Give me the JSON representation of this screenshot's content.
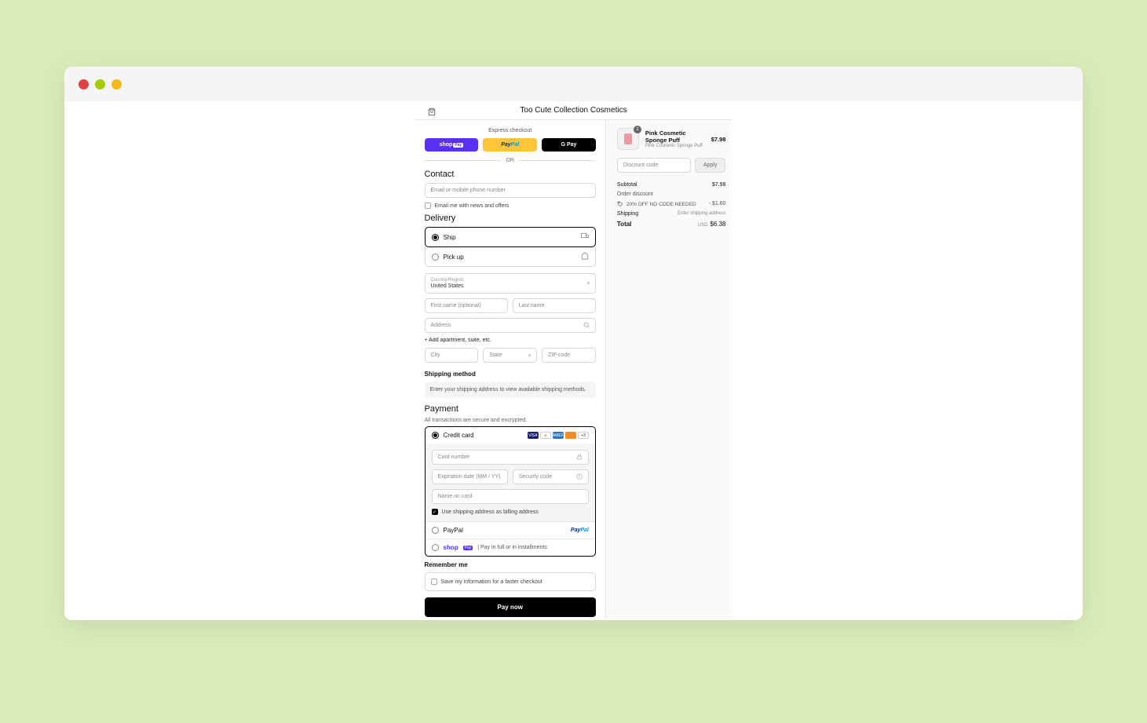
{
  "store_name": "Too Cute Collection Cosmetics",
  "express": {
    "label": "Express checkout",
    "shoppay": "shop Pay",
    "paypal": "PayPal",
    "gpay": "G Pay",
    "or": "OR"
  },
  "contact": {
    "title": "Contact",
    "placeholder": "Email or mobile phone number",
    "newsletter": "Email me with news and offers"
  },
  "delivery": {
    "title": "Delivery",
    "ship": "Ship",
    "pickup": "Pick up",
    "country_label": "Country/Region",
    "country_value": "United States",
    "first_name": "First name (optional)",
    "last_name": "Last name",
    "address": "Address",
    "add_apt": "+ Add apartment, suite, etc.",
    "city": "City",
    "state": "State",
    "zip": "ZIP code",
    "shipping_method_title": "Shipping method",
    "shipping_method_msg": "Enter your shipping address to view available shipping methods."
  },
  "payment": {
    "title": "Payment",
    "subtitle": "All transactions are secure and encrypted.",
    "credit_card": "Credit card",
    "card_number": "Card number",
    "expiry": "Expiration date (MM / YY)",
    "cvv": "Security code",
    "name_on_card": "Name on card",
    "use_shipping": "Use shipping address as billing address",
    "paypal": "PayPal",
    "shoppay_label": "Pay in full or in installments",
    "paypal_logo": "PayPal"
  },
  "remember": {
    "title": "Remember me",
    "label": "Save my information for a faster checkout"
  },
  "pay_now": "Pay now",
  "summary": {
    "item": {
      "qty": "1",
      "name": "Pink Cosmetic Sponge Puff",
      "variant": "Pink Cosmetic Sponge Puff",
      "price": "$7.98"
    },
    "discount_placeholder": "Discount code",
    "apply": "Apply",
    "subtotal_label": "Subtotal",
    "subtotal_value": "$7.98",
    "order_discount_label": "Order discount",
    "discount_name": "20% OFF NO CODE NEEDED",
    "discount_value": "- $1.60",
    "shipping_label": "Shipping",
    "shipping_value": "Enter shipping address",
    "total_label": "Total",
    "total_currency": "USD",
    "total_value": "$6.38"
  }
}
